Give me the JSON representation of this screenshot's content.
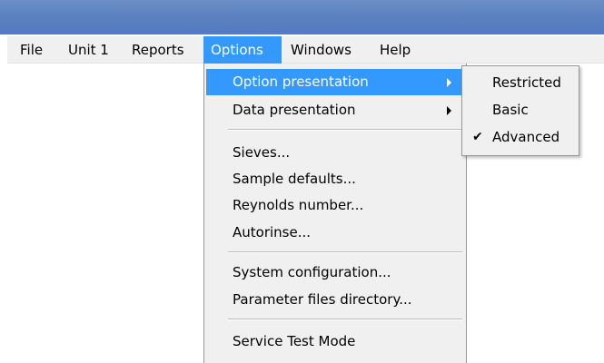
{
  "menubar": {
    "items": [
      {
        "label": "File"
      },
      {
        "label": "Unit 1"
      },
      {
        "label": "Reports"
      },
      {
        "label": "Options"
      },
      {
        "label": "Windows"
      },
      {
        "label": "Help"
      }
    ]
  },
  "options_menu": {
    "option_presentation": "Option presentation",
    "data_presentation": "Data presentation",
    "sieves": "Sieves...",
    "sample_defaults": "Sample defaults...",
    "reynolds_number": "Reynolds number...",
    "autorinse": "Autorinse...",
    "system_configuration": "System configuration...",
    "parameter_files_directory": "Parameter files directory...",
    "service_test_mode": "Service Test Mode"
  },
  "option_presentation_submenu": {
    "items": [
      {
        "label": "Restricted",
        "checked": false
      },
      {
        "label": "Basic",
        "checked": false
      },
      {
        "label": "Advanced",
        "checked": true
      }
    ],
    "check_glyph": "✔"
  },
  "colors": {
    "titlebar": "#5c82c0",
    "highlight": "#3399ff",
    "menu_background": "#f0f0f0"
  }
}
